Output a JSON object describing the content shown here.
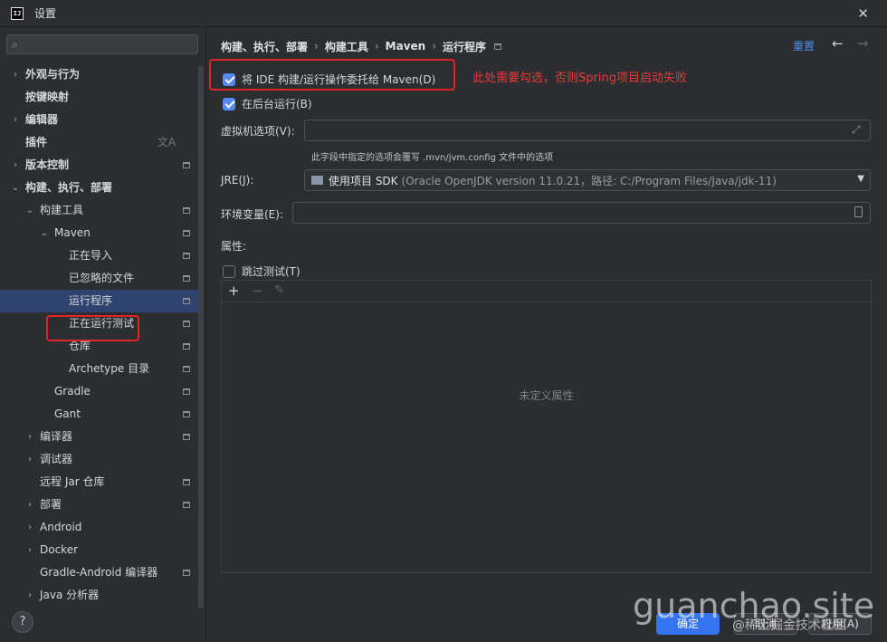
{
  "window": {
    "title": "设置",
    "icon_text": "IJ"
  },
  "search": {
    "placeholder": ""
  },
  "sidebar": {
    "items": [
      {
        "label": "外观与行为",
        "bold": true,
        "chevron": "›"
      },
      {
        "label": "按键映射",
        "bold": true
      },
      {
        "label": "编辑器",
        "bold": true,
        "chevron": "›"
      },
      {
        "label": "插件",
        "bold": true,
        "icon": "translate-icon"
      },
      {
        "label": "版本控制",
        "bold": true,
        "chevron": "›",
        "pin": true
      },
      {
        "label": "构建、执行、部署",
        "bold": true,
        "chevron": "⌄"
      },
      {
        "label": "构建工具",
        "chevron": "⌄",
        "pin": true
      },
      {
        "label": "Maven",
        "chevron": "⌄",
        "pin": true
      },
      {
        "label": "正在导入",
        "pin": true
      },
      {
        "label": "已忽略的文件",
        "pin": true
      },
      {
        "label": "运行程序",
        "pin": true,
        "selected": true
      },
      {
        "label": "正在运行测试",
        "pin": true
      },
      {
        "label": "仓库",
        "pin": true
      },
      {
        "label": "Archetype 目录",
        "pin": true
      },
      {
        "label": "Gradle",
        "pin": true
      },
      {
        "label": "Gant",
        "pin": true
      },
      {
        "label": "编译器",
        "chevron": "›",
        "pin": true
      },
      {
        "label": "调试器",
        "chevron": "›"
      },
      {
        "label": "远程 Jar 仓库",
        "pin": true
      },
      {
        "label": "部署",
        "chevron": "›",
        "pin": true
      },
      {
        "label": "Android",
        "chevron": "›"
      },
      {
        "label": "Docker",
        "chevron": "›"
      },
      {
        "label": "Gradle-Android 编译器",
        "pin": true
      },
      {
        "label": "Java 分析器",
        "chevron": "›"
      }
    ]
  },
  "breadcrumb": {
    "items": [
      "构建、执行、部署",
      "构建工具",
      "Maven",
      "运行程序"
    ],
    "separator": "›"
  },
  "header": {
    "reset_label": "重置",
    "back_icon": "←",
    "forward_icon": "→"
  },
  "options": {
    "delegate_label": "将 IDE 构建/运行操作委托给 Maven(D)",
    "delegate_checked": true,
    "background_label": "在后台运行(B)",
    "background_checked": true,
    "annotation": "此处需要勾选，否则Spring项目启动失败"
  },
  "vm_options": {
    "label": "虚拟机选项(V):",
    "value": "",
    "hint": "此字段中指定的选项会覆写 .mvn/jvm.config 文件中的选项"
  },
  "jre": {
    "label": "JRE(J):",
    "value": "使用项目 SDK",
    "detail": "(Oracle OpenJDK version 11.0.21，路径: C:/Program Files/Java/jdk-11)"
  },
  "env": {
    "label": "环境变量(E):",
    "value": ""
  },
  "properties": {
    "label": "属性:",
    "skip_tests_label": "跳过测试(T)",
    "skip_tests_checked": false,
    "add_icon": "+",
    "remove_icon": "−",
    "edit_icon": "✎",
    "empty_text": "未定义属性"
  },
  "footer": {
    "help_label": "?",
    "ok_label": "确定",
    "cancel_label": "取消",
    "apply_label": "应用(A)"
  },
  "watermark": {
    "main": "guanchao.site",
    "sub": "@稀土掘金技术社区"
  },
  "colors": {
    "accent": "#3574f0",
    "link": "#4b8ef0",
    "selection": "#2e436e",
    "annotation": "#e83a3a"
  }
}
